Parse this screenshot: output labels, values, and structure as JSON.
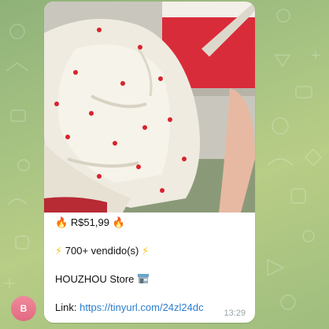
{
  "message": {
    "price_line": {
      "left_icon": "fire-icon",
      "text": "R$51,99",
      "right_icon": "fire-icon"
    },
    "sold_line": {
      "left_icon": "lightning-icon",
      "text": "700+ vendido(s)",
      "right_icon": "lightning-icon"
    },
    "store_line": {
      "text": "HOUZHOU Store",
      "icon": "shop-icon"
    },
    "link_line": {
      "label": "Link:",
      "url": "https://tinyurl.com/24zl24dc"
    },
    "time": "13:29"
  },
  "avatar": {
    "initial": "B",
    "color": "#e9778c"
  },
  "colors": {
    "link": "#2a7ed0",
    "fire": "#f25a1e",
    "lightning": "#f7c21c"
  }
}
